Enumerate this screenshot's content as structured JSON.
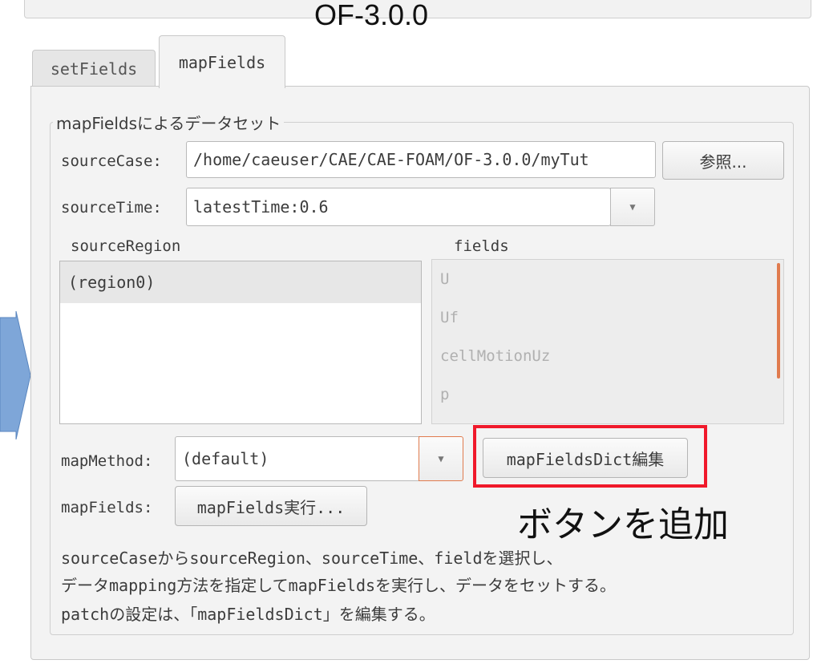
{
  "version_title": "OF-3.0.0",
  "tabs": [
    {
      "label": "setFields"
    },
    {
      "label": "mapFields"
    }
  ],
  "group_title": "mapFieldsによるデータセット",
  "source_case": {
    "label": "sourceCase:",
    "value": "/home/caeuser/CAE/CAE-FOAM/OF-3.0.0/myTut",
    "browse_label": "参照..."
  },
  "source_time": {
    "label": "sourceTime:",
    "value": "latestTime:0.6"
  },
  "source_region": {
    "header": "sourceRegion",
    "items": [
      "(region0)"
    ]
  },
  "fields": {
    "header": "fields",
    "items": [
      "U",
      "Uf",
      "cellMotionUz",
      "p"
    ]
  },
  "map_method": {
    "label": "mapMethod:",
    "value": "(default)",
    "edit_dict_label": "mapFieldsDict編集"
  },
  "map_fields": {
    "label": "mapFields:",
    "run_label": "mapFields実行..."
  },
  "annotation": "ボタンを追加",
  "description": [
    "sourceCaseからsourceRegion、sourceTime、fieldを選択し、",
    "データmapping方法を指定してmapFieldsを実行し、データをセットする。",
    "patchの設定は、「mapFieldsDict」を編集する。"
  ],
  "colors": {
    "highlight": "#f0192b",
    "arrow": "#7ea6d8",
    "scroll_thumb": "#e07b4e"
  },
  "icons": {
    "combo_arrow": "triangle-down-icon"
  }
}
